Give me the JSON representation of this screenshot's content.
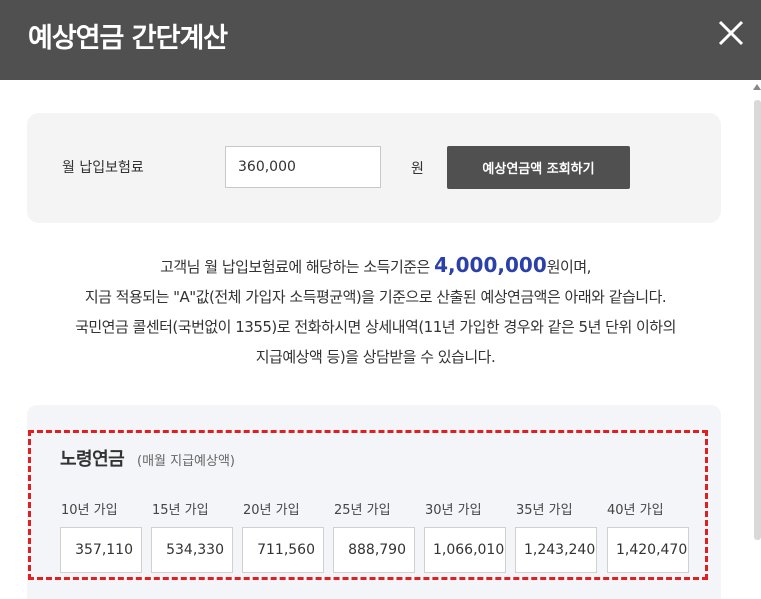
{
  "header": {
    "title": "예상연금 간단계산"
  },
  "form": {
    "label": "월 납입보험료",
    "value": "360,000",
    "unit": "원",
    "button_label": "예상연금액 조회하기"
  },
  "description": {
    "line1_prefix": "고객님 월 납입보험료에 해당하는 소득기준은 ",
    "line1_amount": "4,000,000",
    "line1_suffix": "원이며,",
    "line2": "지금 적용되는 \"A\"값(전체 가입자 소득평균액)을 기준으로 산출된 예상연금액은 아래와 같습니다.",
    "line3": "국민연금 콜센터(국번없이 1355)로 전화하시면 상세내역(11년 가입한 경우와 같은 5년 단위 이하의",
    "line4": "지급예상액 등)을 상담받을 수 있습니다."
  },
  "result": {
    "title": "노령연금",
    "subtitle": "(매월 지급예상액)",
    "terms": [
      {
        "label": "10년 가입",
        "value": "357,110"
      },
      {
        "label": "15년 가입",
        "value": "534,330"
      },
      {
        "label": "20년 가입",
        "value": "711,560"
      },
      {
        "label": "25년 가입",
        "value": "888,790"
      },
      {
        "label": "30년 가입",
        "value": "1,066,010"
      },
      {
        "label": "35년 가입",
        "value": "1,243,240"
      },
      {
        "label": "40년 가입",
        "value": "1,420,470"
      }
    ]
  },
  "colors": {
    "header_bg": "#505050",
    "highlight": "#2b40a9",
    "dashed_border": "#e02020"
  }
}
